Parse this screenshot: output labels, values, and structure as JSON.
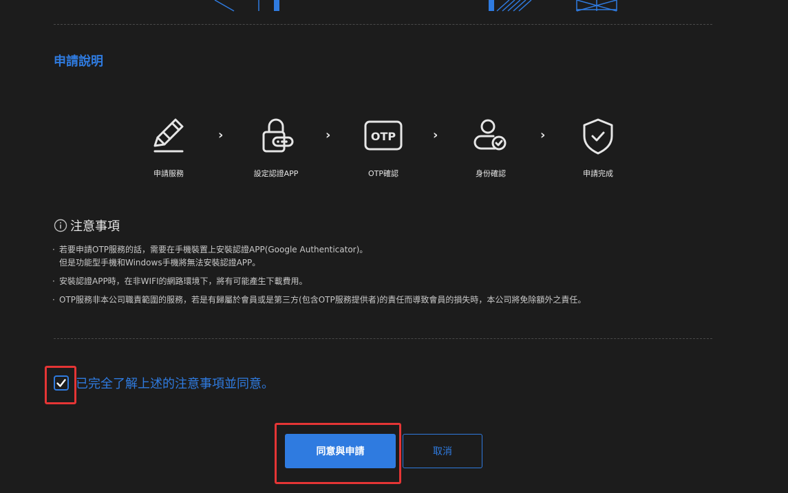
{
  "section": {
    "title": "申請說明"
  },
  "steps": [
    {
      "label": "申請服務",
      "icon": "pencil-icon"
    },
    {
      "label": "設定認證APP",
      "icon": "lock-icon"
    },
    {
      "label": "OTP確認",
      "icon": "otp-icon",
      "icon_text": "OTP"
    },
    {
      "label": "身份確認",
      "icon": "user-check-icon"
    },
    {
      "label": "申請完成",
      "icon": "shield-check-icon"
    }
  ],
  "step_arrow": "›",
  "notes": {
    "title": "注意事項",
    "items": [
      {
        "lines": [
          "若要申請OTP服務的話，需要在手機裝置上安裝認證APP(Google Authenticator)。",
          "但是功能型手機和Windows手機將無法安裝認證APP。"
        ]
      },
      {
        "lines": [
          "安裝認證APP時，在非WIFI的網路環境下，將有可能產生下載費用。"
        ]
      },
      {
        "lines": [
          "OTP服務非本公司職責範圍的服務，若是有歸屬於會員或是第三方(包含OTP服務提供者)的責任而導致會員的損失時，本公司將免除額外之責任。"
        ]
      }
    ]
  },
  "agreement": {
    "checked": true,
    "text": "已完全了解上述的注意事項並同意。"
  },
  "buttons": {
    "submit": "同意與申請",
    "cancel": "取消"
  },
  "colors": {
    "accent": "#2f7be0",
    "background": "#1c1c1c",
    "highlight": "#e53535"
  }
}
